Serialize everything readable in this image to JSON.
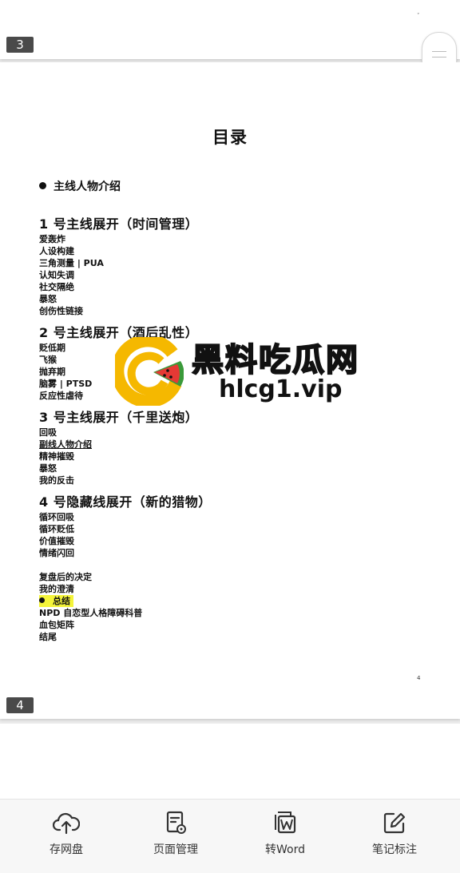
{
  "top_page": {
    "badge": "3",
    "corner_mark": "ˇ"
  },
  "main_page": {
    "badge": "4",
    "page_number": "4",
    "title": "目录",
    "intro_heading": "主线人物介绍",
    "sections": [
      {
        "heading": "1 号主线展开（时间管理）",
        "items": [
          "爱轰炸",
          "人设构建",
          "三角测量 | PUA",
          "认知失调",
          "社交隔绝",
          "暴怒",
          "创伤性链接"
        ]
      },
      {
        "heading": "2 号主线展开（酒后乱性）",
        "items": [
          "贬低期",
          "飞猴",
          "抛弃期",
          "脑雾 | PTSD",
          "反应性虐待"
        ]
      },
      {
        "heading": "3 号主线展开（千里送炮）",
        "items": [
          "回吸",
          "副线人物介绍",
          "精神摧毁",
          "暴怒",
          "我的反击"
        ]
      },
      {
        "heading": "4 号隐藏线展开（新的猎物）",
        "items": [
          "循环回吸",
          "循环贬低",
          "价值摧毁",
          "情绪闪回"
        ]
      }
    ],
    "tail_items": [
      "复盘后的决定",
      "我的澄清"
    ],
    "highlighted_item": "总结",
    "after_items": [
      "NPD 自恋型人格障碍科普",
      "血包矩阵",
      "结尾"
    ]
  },
  "watermark": {
    "title": "黑料吃瓜网",
    "url": "hlcg1.vip"
  },
  "toolbar": {
    "items": [
      {
        "label": "存网盘",
        "icon": "cloud-upload-icon"
      },
      {
        "label": "页面管理",
        "icon": "page-settings-icon"
      },
      {
        "label": "转Word",
        "icon": "word-convert-icon"
      },
      {
        "label": "笔记标注",
        "icon": "edit-note-icon"
      }
    ]
  },
  "colors": {
    "highlight": "#f4f43a",
    "logo_yellow": "#f5b800",
    "toolbar_bg": "#f7f7f7"
  }
}
